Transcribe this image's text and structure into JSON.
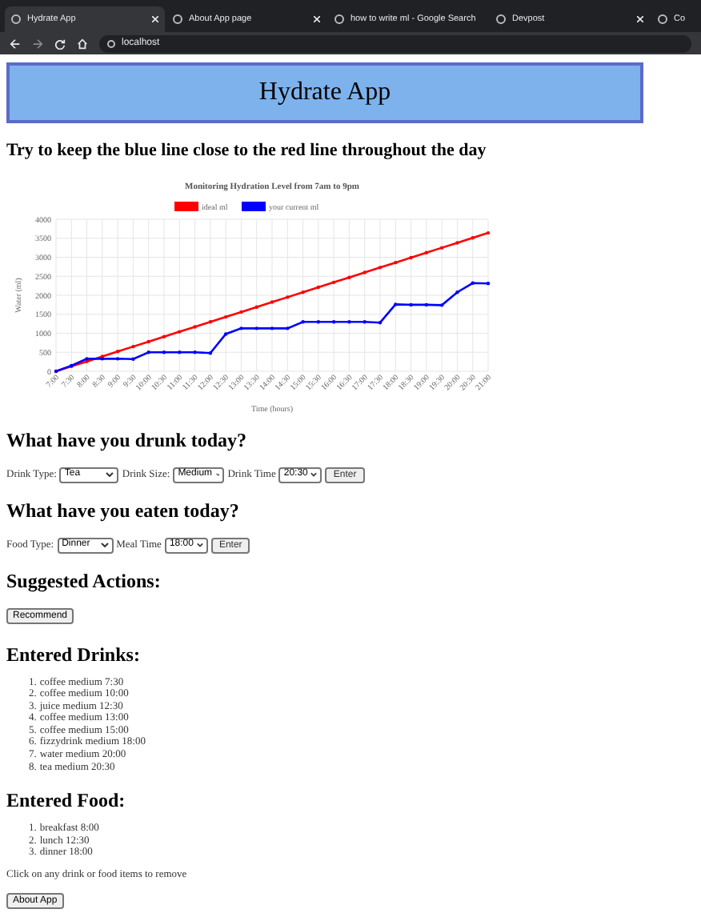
{
  "browser": {
    "tabs": [
      {
        "title": "Hydrate App",
        "selected": true
      },
      {
        "title": "About App page",
        "selected": false
      },
      {
        "title": "how to write ml - Google Search",
        "selected": false
      },
      {
        "title": "Devpost",
        "selected": false
      },
      {
        "title": "Co",
        "selected": false
      }
    ],
    "address": "localhost"
  },
  "header": {
    "title": "Hydrate App"
  },
  "intro": "Try to keep the blue line close to the red line throughout the day",
  "chart": {
    "chart_data": {
      "type": "line",
      "title": "Monitoring Hydration Level from 7am to 9pm",
      "xlabel": "Time (hours)",
      "ylabel": "Water (ml)",
      "categories": [
        "7:00",
        "7:30",
        "8:00",
        "8:30",
        "9:00",
        "9:30",
        "10:00",
        "10:30",
        "11:00",
        "11:30",
        "12:00",
        "12:30",
        "13:00",
        "13:30",
        "14:00",
        "14:30",
        "15:00",
        "15:30",
        "16:00",
        "16:30",
        "17:00",
        "17:30",
        "18:00",
        "18:30",
        "19:00",
        "19:30",
        "20:00",
        "20:30",
        "21:00"
      ],
      "grid": true,
      "legend": true,
      "ylim": [
        0,
        4000
      ],
      "yticks": [
        0,
        500,
        1000,
        1500,
        2000,
        2500,
        3000,
        3500,
        4000
      ],
      "series": [
        {
          "name": "ideal ml",
          "color": "#ff0000",
          "values": [
            0,
            130,
            260,
            390,
            520,
            650,
            780,
            910,
            1040,
            1170,
            1300,
            1430,
            1560,
            1690,
            1820,
            1950,
            2080,
            2210,
            2340,
            2470,
            2600,
            2730,
            2860,
            2990,
            3120,
            3250,
            3380,
            3510,
            3640
          ]
        },
        {
          "name": "your current ml",
          "color": "#0000ff",
          "values": [
            0,
            150,
            330,
            330,
            330,
            320,
            500,
            500,
            500,
            500,
            480,
            980,
            1130,
            1130,
            1130,
            1130,
            1300,
            1300,
            1300,
            1300,
            1300,
            1280,
            1760,
            1750,
            1750,
            1740,
            2080,
            2320,
            2310
          ]
        }
      ]
    }
  },
  "drink_form": {
    "heading": "What have you drunk today?",
    "fields": [
      {
        "label": "Drink Type:",
        "value": "Tea"
      },
      {
        "label": "Drink Size:",
        "value": "Medium"
      },
      {
        "label": "Drink Time",
        "value": "20:30"
      }
    ],
    "button": "Enter"
  },
  "food_form": {
    "heading": "What have you eaten today?",
    "fields": [
      {
        "label": "Food Type:",
        "value": "Dinner"
      },
      {
        "label": "Meal Time",
        "value": "18:00"
      }
    ],
    "button": "Enter"
  },
  "suggested": {
    "heading": "Suggested Actions:",
    "button": "Recommend"
  },
  "drinks": {
    "heading": "Entered Drinks:",
    "items": [
      {
        "number": "1.",
        "text": "coffee medium 7:30"
      },
      {
        "number": "2.",
        "text": "coffee medium 10:00"
      },
      {
        "number": "3.",
        "text": "juice medium 12:30"
      },
      {
        "number": "4.",
        "text": "coffee medium 13:00"
      },
      {
        "number": "5.",
        "text": "coffee medium 15:00"
      },
      {
        "number": "6.",
        "text": "fizzydrink medium 18:00"
      },
      {
        "number": "7.",
        "text": "water medium 20:00"
      },
      {
        "number": "8.",
        "text": "tea medium 20:30"
      }
    ]
  },
  "food": {
    "heading": "Entered Food:",
    "items": [
      {
        "number": "1.",
        "text": "breakfast 8:00"
      },
      {
        "number": "2.",
        "text": "lunch 12:30"
      },
      {
        "number": "3.",
        "text": "dinner 18:00"
      }
    ]
  },
  "hint": "Click on any drink or food items to remove",
  "about_button": "About App"
}
